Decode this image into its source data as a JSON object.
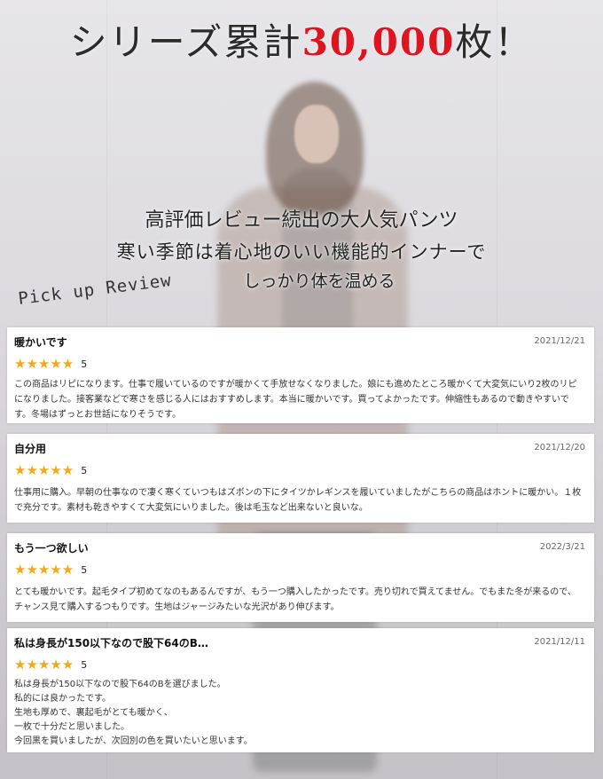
{
  "headline": {
    "prefix": "シリーズ累計",
    "number": "30,000",
    "suffix": "枚！"
  },
  "tagline": {
    "line1": "高評価レビュー続出の大人気パンツ",
    "line2": "寒い季節は着心地のいい機能的インナーで",
    "line3": "しっかり体を温める"
  },
  "section_label": "Pick up Review",
  "colors": {
    "accent_red": "#e0141e",
    "star": "#f0a81c"
  },
  "reviews": [
    {
      "title": "暖かいです",
      "date": "2021/12/21",
      "stars": "★★★★★",
      "score": "5",
      "text": "この商品はリピになります。仕事で履いているのですが暖かくて手放せなくなりました。娘にも進めたところ暖かくて大変気にいり2枚のリピになりました。接客業などで寒さを感じる人にはおすすめします。本当に暖かいです。買ってよかったです。伸縮性もあるので動きやすいです。冬場はずっとお世話になりそうです。"
    },
    {
      "title": "自分用",
      "date": "2021/12/20",
      "stars": "★★★★★",
      "score": "5",
      "text": "仕事用に購入。早朝の仕事なので凄く寒くていつもはズボンの下にタイツかレギンスを履いていましたがこちらの商品はホントに暖かい。１枚で充分です。素材も乾きやすくて大変気にいりました。後は毛玉など出来ないと良いな。"
    },
    {
      "title": "もう一つ欲しい",
      "date": "2022/3/21",
      "stars": "★★★★★",
      "score": "5",
      "text": "とても暖かいです。起毛タイプ初めてなのもあるんですが、もう一つ購入したかったです。売り切れで買えてません。でもまた冬が来るので、チャンス見て購入するつもりです。生地はジャージみたいな光沢があり伸びます。"
    },
    {
      "title": "私は身長が150以下なので股下64のB…",
      "date": "2021/12/11",
      "stars": "★★★★★",
      "score": "5",
      "text": "私は身長が150以下なので股下64のBを選びました。\n私的には良かったです。\n生地も厚めで、裏起毛がとても暖かく、\n一枚で十分だと思いました。\n今回黒を買いましたが、次回別の色を買いたいと思います。"
    }
  ]
}
